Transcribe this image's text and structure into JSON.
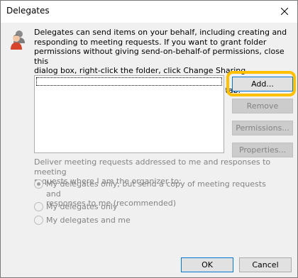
{
  "window": {
    "title": "Delegates"
  },
  "info": {
    "text": "Delegates can send items on your behalf, including creating and\nresponding to meeting requests. If you want to grant folder\npermissions without giving send-on-behalf-of permissions, close this\ndialog box, right-click the folder, click Change Sharing Permissions,\nand then change the options on the Permissions tab."
  },
  "buttons": {
    "add": "Add...",
    "remove": "Remove",
    "permissions": "Permissions...",
    "properties": "Properties..."
  },
  "deliver": {
    "label": "Deliver meeting requests addressed to me and responses to meeting\nrequests where I am the organizer to:",
    "options": [
      {
        "label": "My delegates only, but send a copy of meeting requests and\nresponses to me (recommended)",
        "checked": true
      },
      {
        "label": "My delegates only",
        "checked": false
      },
      {
        "label": "My delegates and me",
        "checked": false
      }
    ]
  },
  "footer": {
    "ok": "OK",
    "cancel": "Cancel"
  },
  "colors": {
    "highlight": "#ffc000",
    "focus_border": "#0078d7"
  },
  "icons": {
    "title_close": "close-icon",
    "people": "people-icon"
  }
}
